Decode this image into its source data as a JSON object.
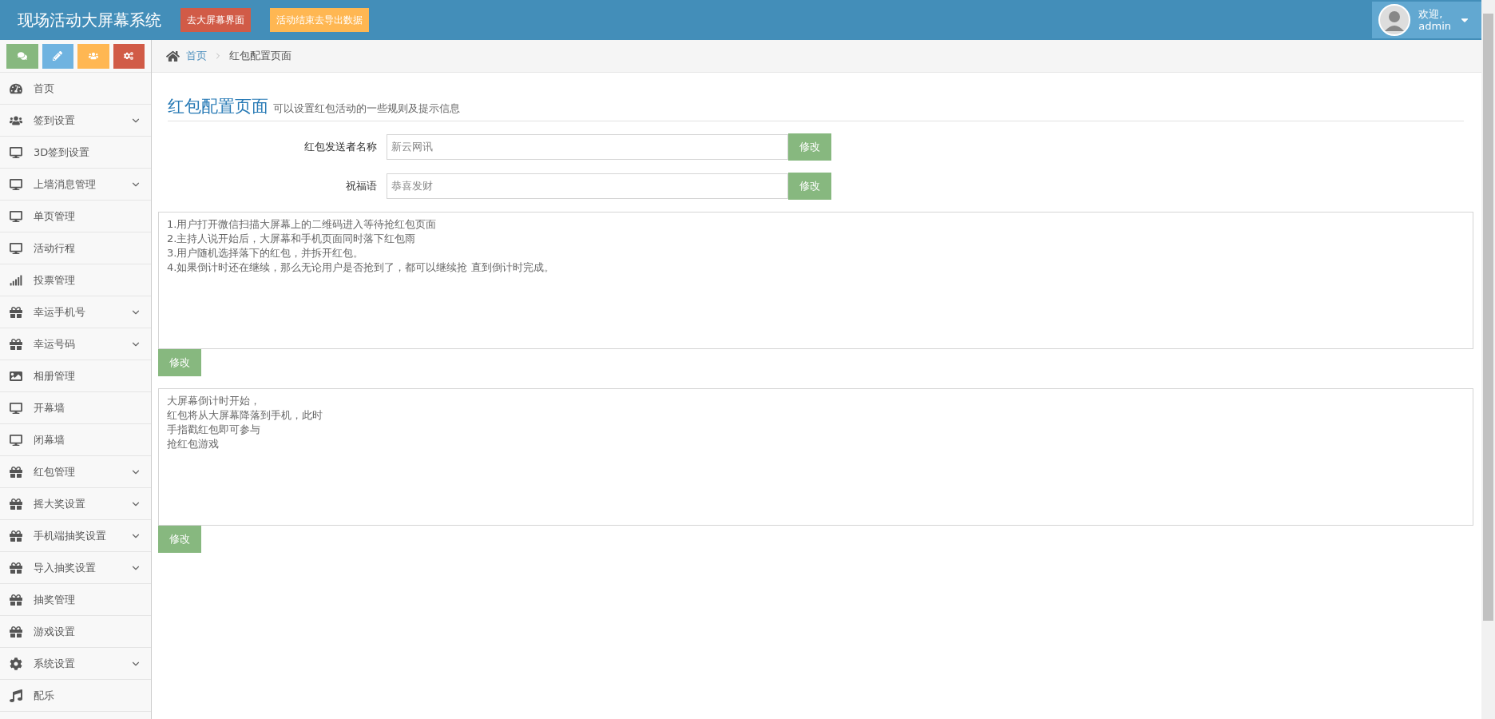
{
  "header": {
    "title": "现场活动大屏幕系统",
    "buttons": [
      {
        "label": "去大屏幕界面",
        "kind": "danger"
      },
      {
        "label": "活动结束去导出数据",
        "kind": "warning"
      }
    ],
    "user": {
      "greeting": "欢迎,",
      "name": "admin"
    }
  },
  "sidebar": {
    "shortcuts": [
      {
        "kind": "comments",
        "color": "#87b87f"
      },
      {
        "kind": "pencil",
        "color": "#6fb3e0"
      },
      {
        "kind": "users",
        "color": "#ffb752"
      },
      {
        "kind": "cogs",
        "color": "#d15b47"
      }
    ],
    "items": [
      {
        "label": "首页",
        "kind": "gauge",
        "expandable": false
      },
      {
        "label": "签到设置",
        "kind": "users",
        "expandable": true
      },
      {
        "label": "3D签到设置",
        "kind": "monitor",
        "expandable": false
      },
      {
        "label": "上墙消息管理",
        "kind": "monitor",
        "expandable": true
      },
      {
        "label": "单页管理",
        "kind": "monitor",
        "expandable": false
      },
      {
        "label": "活动行程",
        "kind": "monitor",
        "expandable": false
      },
      {
        "label": "投票管理",
        "kind": "signal",
        "expandable": false
      },
      {
        "label": "幸运手机号",
        "kind": "gift",
        "expandable": true
      },
      {
        "label": "幸运号码",
        "kind": "gift",
        "expandable": true
      },
      {
        "label": "相册管理",
        "kind": "image",
        "expandable": false
      },
      {
        "label": "开幕墙",
        "kind": "monitor",
        "expandable": false
      },
      {
        "label": "闭幕墙",
        "kind": "monitor",
        "expandable": false
      },
      {
        "label": "红包管理",
        "kind": "gift",
        "expandable": true
      },
      {
        "label": "摇大奖设置",
        "kind": "gift",
        "expandable": true
      },
      {
        "label": "手机端抽奖设置",
        "kind": "gift",
        "expandable": true
      },
      {
        "label": "导入抽奖设置",
        "kind": "gift",
        "expandable": true
      },
      {
        "label": "抽奖管理",
        "kind": "gift",
        "expandable": false
      },
      {
        "label": "游戏设置",
        "kind": "gift",
        "expandable": false
      },
      {
        "label": "系统设置",
        "kind": "cog",
        "expandable": true
      },
      {
        "label": "配乐",
        "kind": "music",
        "expandable": false
      }
    ]
  },
  "breadcrumb": [
    {
      "label": "首页"
    },
    {
      "label": "红包配置页面"
    }
  ],
  "page": {
    "title": "红包配置页面",
    "subtitle": "可以设置红包活动的一些规则及提示信息",
    "fields": [
      {
        "label": "红包发送者名称",
        "value": "新云网讯",
        "button": "修改"
      },
      {
        "label": "祝福语",
        "value": "恭喜发财",
        "button": "修改"
      }
    ],
    "text_blocks": [
      {
        "lines": [
          "1.用户打开微信扫描大屏幕上的二维码进入等待抢红包页面",
          "2.主持人说开始后，大屏幕和手机页面同时落下红包雨",
          "3.用户随机选择落下的红包，并拆开红包。",
          "4.如果倒计时还在继续，那么无论用户是否抢到了，都可以继续抢 直到倒计时完成。"
        ],
        "button": "修改"
      },
      {
        "lines": [
          "大屏幕倒计时开始，",
          "红包将从大屏幕降落到手机，此时",
          "手指戳红包即可参与",
          "抢红包游戏"
        ],
        "button": "修改"
      }
    ]
  }
}
